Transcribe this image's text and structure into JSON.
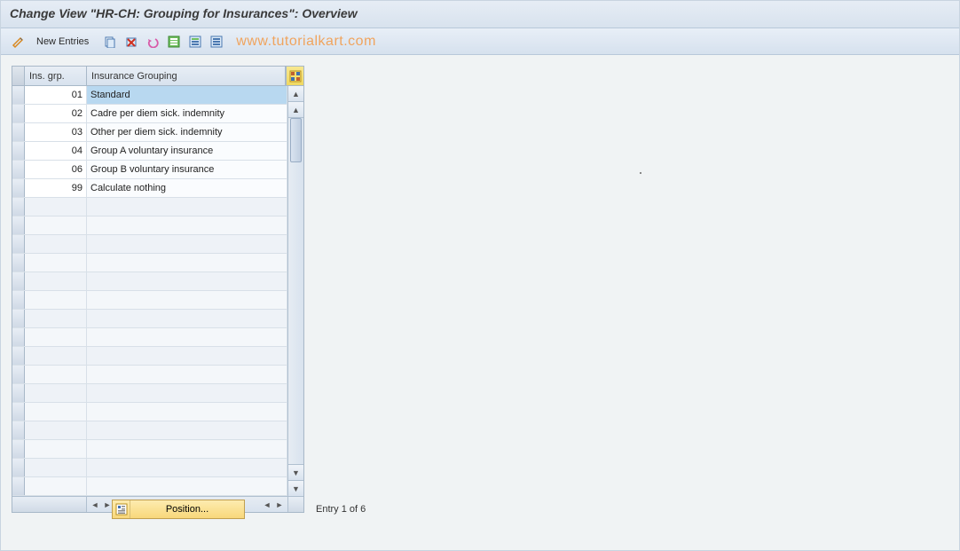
{
  "title": "Change View \"HR-CH: Grouping for Insurances\": Overview",
  "toolbar": {
    "new_entries_label": "New Entries",
    "icons": {
      "pencil": "pencil-icon",
      "copy": "copy-icon",
      "delete": "delete-icon",
      "undo": "undo-icon",
      "select_all": "select-all-icon",
      "select_block": "select-block-icon",
      "deselect_all": "deselect-all-icon"
    }
  },
  "watermark": "www.tutorialkart.com",
  "table": {
    "columns": {
      "ins_grp": "Ins. grp.",
      "insurance_grouping": "Insurance Grouping"
    },
    "rows": [
      {
        "code": "01",
        "desc": "Standard",
        "selected": true
      },
      {
        "code": "02",
        "desc": "Cadre per diem sick. indemnity",
        "selected": false
      },
      {
        "code": "03",
        "desc": "Other per diem sick. indemnity",
        "selected": false
      },
      {
        "code": "04",
        "desc": "Group A voluntary insurance",
        "selected": false
      },
      {
        "code": "06",
        "desc": "Group B voluntary insurance",
        "selected": false
      },
      {
        "code": "99",
        "desc": "Calculate nothing",
        "selected": false
      }
    ],
    "empty_rows_count": 16
  },
  "footer": {
    "position_label": "Position...",
    "entry_status": "Entry 1 of 6"
  }
}
